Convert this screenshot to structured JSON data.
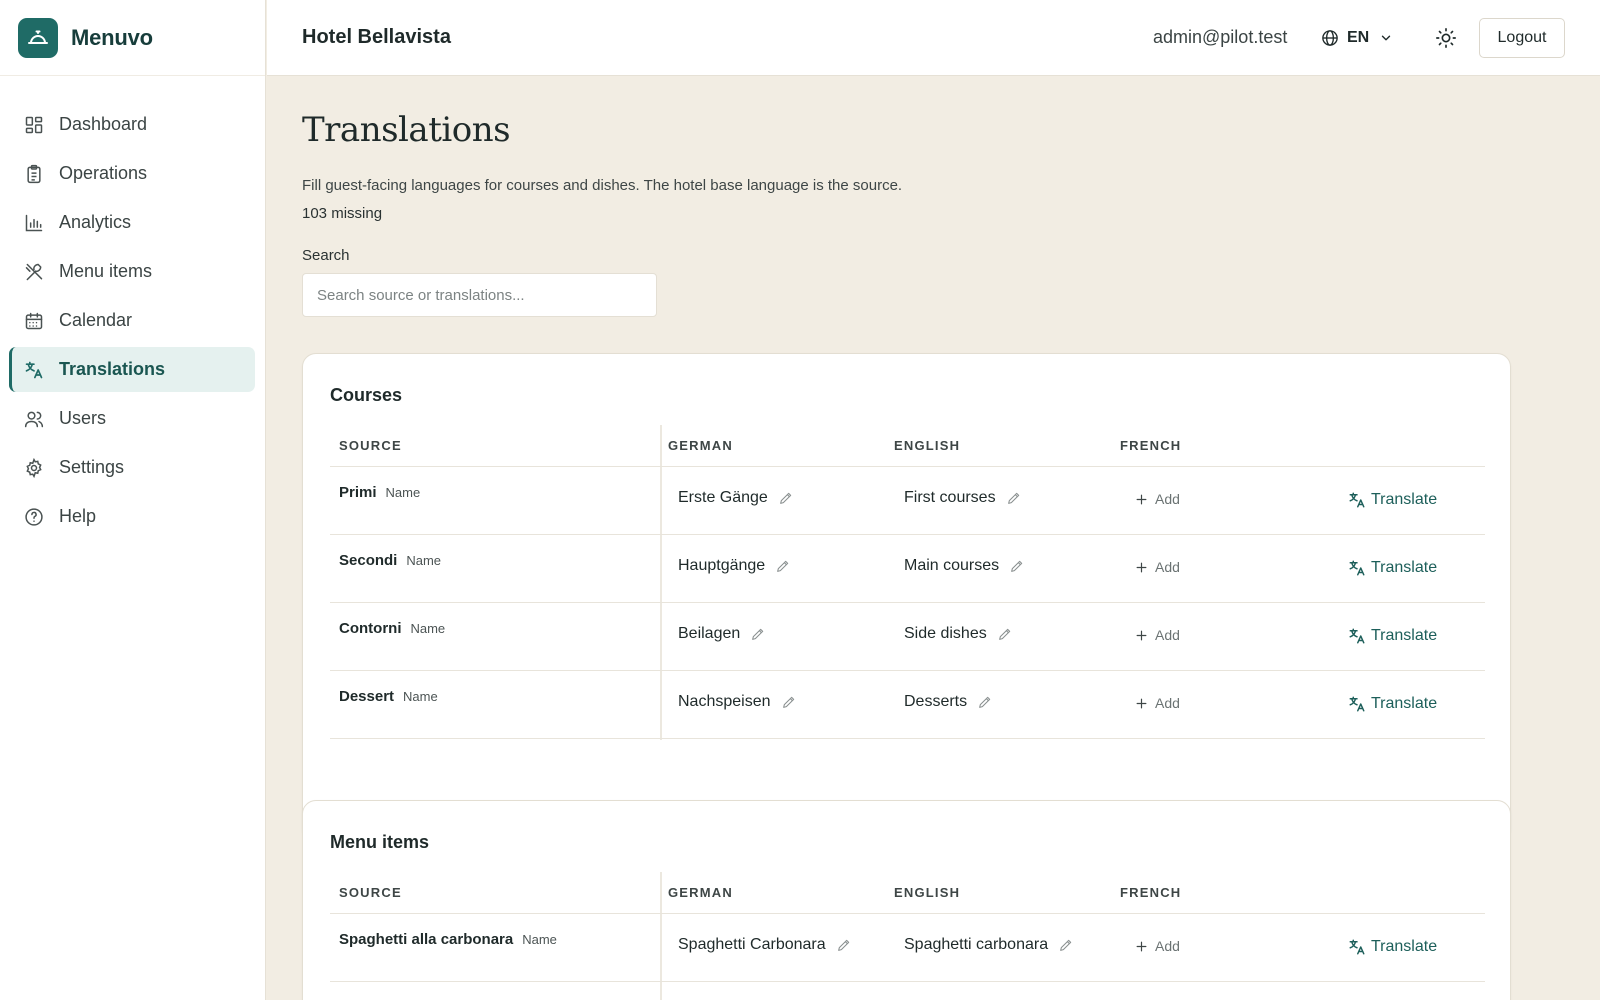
{
  "brand": {
    "name": "Menuvo",
    "accent": "#1f6b66"
  },
  "sidebar": {
    "items": [
      {
        "label": "Dashboard",
        "icon": "dashboard-icon",
        "active": false
      },
      {
        "label": "Operations",
        "icon": "clipboard-icon",
        "active": false
      },
      {
        "label": "Analytics",
        "icon": "bar-chart-icon",
        "active": false
      },
      {
        "label": "Menu items",
        "icon": "utensils-icon",
        "active": false
      },
      {
        "label": "Calendar",
        "icon": "calendar-icon",
        "active": false
      },
      {
        "label": "Translations",
        "icon": "translate-icon",
        "active": true
      },
      {
        "label": "Users",
        "icon": "users-icon",
        "active": false
      },
      {
        "label": "Settings",
        "icon": "gear-icon",
        "active": false
      },
      {
        "label": "Help",
        "icon": "help-icon",
        "active": false
      }
    ]
  },
  "header": {
    "hotel_name": "Hotel Bellavista",
    "user_email": "admin@pilot.test",
    "language": "EN",
    "logout_label": "Logout"
  },
  "page": {
    "title": "Translations",
    "description": "Fill guest-facing languages for courses and dishes. The hotel base language is the source.",
    "missing": "103 missing",
    "search_label": "Search",
    "search_placeholder": "Search source or translations..."
  },
  "columns": {
    "source": "SOURCE",
    "german": "GERMAN",
    "english": "ENGLISH",
    "french": "FRENCH"
  },
  "actions": {
    "add": "Add",
    "translate": "Translate"
  },
  "courses": {
    "title": "Courses",
    "rows": [
      {
        "source": "Primi",
        "type": "Name",
        "german": "Erste Gänge",
        "english": "First courses",
        "french": ""
      },
      {
        "source": "Secondi",
        "type": "Name",
        "german": "Hauptgänge",
        "english": "Main courses",
        "french": ""
      },
      {
        "source": "Contorni",
        "type": "Name",
        "german": "Beilagen",
        "english": "Side dishes",
        "french": ""
      },
      {
        "source": "Dessert",
        "type": "Name",
        "german": "Nachspeisen",
        "english": "Desserts",
        "french": ""
      }
    ]
  },
  "menu_items": {
    "title": "Menu items",
    "rows": [
      {
        "source": "Spaghetti alla carbonara",
        "type": "Name",
        "german": "Spaghetti Carbonara",
        "english": "Spaghetti carbonara",
        "french": ""
      }
    ]
  }
}
